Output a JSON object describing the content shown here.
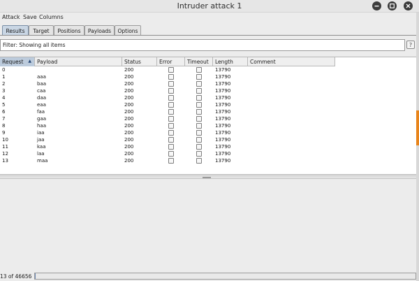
{
  "window": {
    "title": "Intruder attack 1"
  },
  "menu": [
    "Attack",
    "Save",
    "Columns"
  ],
  "tabs": [
    {
      "label": "Results",
      "active": true
    },
    {
      "label": "Target",
      "active": false
    },
    {
      "label": "Positions",
      "active": false
    },
    {
      "label": "Payloads",
      "active": false
    },
    {
      "label": "Options",
      "active": false
    }
  ],
  "filter": {
    "text": "Filter: Showing all items",
    "help": "?"
  },
  "table": {
    "columns": [
      "Request",
      "Payload",
      "Status",
      "Error",
      "Timeout",
      "Length",
      "Comment"
    ],
    "sort_column": "Request",
    "sort_direction": "ascending",
    "sort_indicator": "▲",
    "rows": [
      {
        "request": "0",
        "payload": "",
        "status": "200",
        "error": false,
        "timeout": false,
        "length": "13790",
        "comment": ""
      },
      {
        "request": "1",
        "payload": "aaa",
        "status": "200",
        "error": false,
        "timeout": false,
        "length": "13790",
        "comment": ""
      },
      {
        "request": "2",
        "payload": "baa",
        "status": "200",
        "error": false,
        "timeout": false,
        "length": "13790",
        "comment": ""
      },
      {
        "request": "3",
        "payload": "caa",
        "status": "200",
        "error": false,
        "timeout": false,
        "length": "13790",
        "comment": ""
      },
      {
        "request": "4",
        "payload": "daa",
        "status": "200",
        "error": false,
        "timeout": false,
        "length": "13790",
        "comment": ""
      },
      {
        "request": "5",
        "payload": "eaa",
        "status": "200",
        "error": false,
        "timeout": false,
        "length": "13790",
        "comment": ""
      },
      {
        "request": "6",
        "payload": "faa",
        "status": "200",
        "error": false,
        "timeout": false,
        "length": "13790",
        "comment": ""
      },
      {
        "request": "7",
        "payload": "gaa",
        "status": "200",
        "error": false,
        "timeout": false,
        "length": "13790",
        "comment": ""
      },
      {
        "request": "8",
        "payload": "haa",
        "status": "200",
        "error": false,
        "timeout": false,
        "length": "13790",
        "comment": ""
      },
      {
        "request": "9",
        "payload": "iaa",
        "status": "200",
        "error": false,
        "timeout": false,
        "length": "13790",
        "comment": ""
      },
      {
        "request": "10",
        "payload": "jaa",
        "status": "200",
        "error": false,
        "timeout": false,
        "length": "13790",
        "comment": ""
      },
      {
        "request": "11",
        "payload": "kaa",
        "status": "200",
        "error": false,
        "timeout": false,
        "length": "13790",
        "comment": ""
      },
      {
        "request": "12",
        "payload": "laa",
        "status": "200",
        "error": false,
        "timeout": false,
        "length": "13790",
        "comment": ""
      },
      {
        "request": "13",
        "payload": "maa",
        "status": "200",
        "error": false,
        "timeout": false,
        "length": "13790",
        "comment": ""
      }
    ]
  },
  "status": {
    "progress_text": "13 of 46656",
    "progress_fraction": 0.0003
  },
  "colors": {
    "active_tab": "#c9d6e4",
    "progress_fill": "#6b88b4",
    "accent_edge": "#e8841a"
  },
  "icons": {
    "minimize": "minimize-icon",
    "maximize": "maximize-icon",
    "close": "close-icon",
    "sort": "sort-ascending-icon"
  }
}
